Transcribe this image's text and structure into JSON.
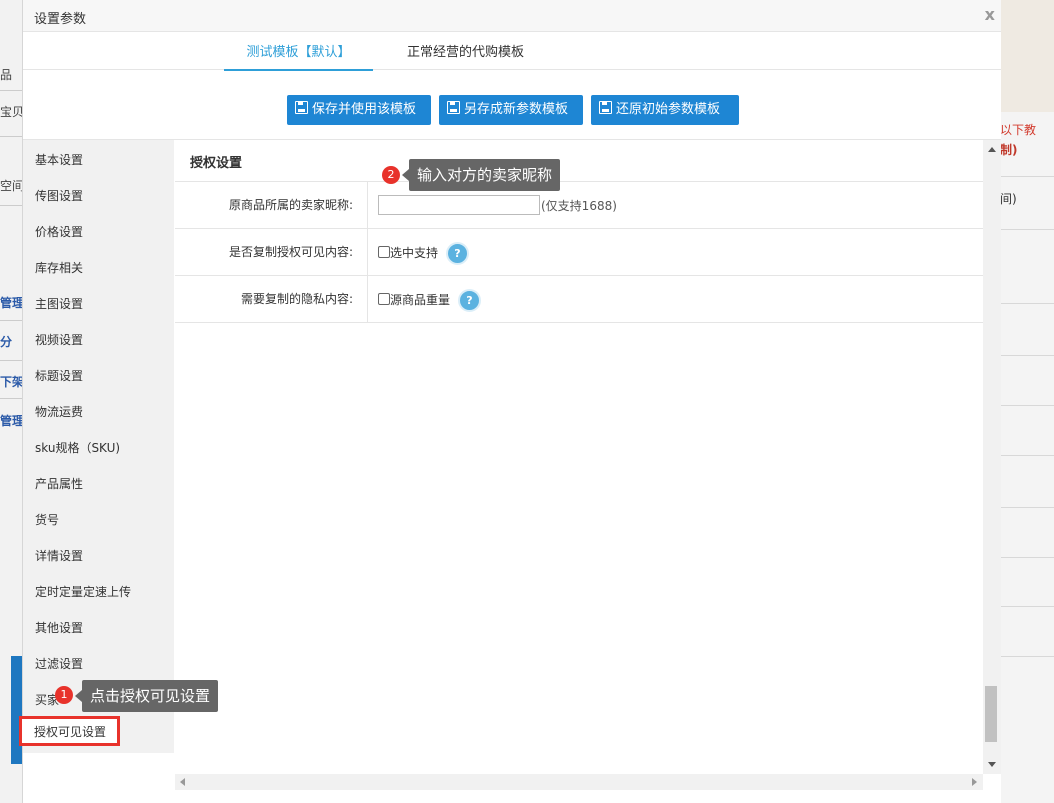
{
  "dialog": {
    "title": "设置参数",
    "close_label": "x"
  },
  "tabs": [
    {
      "label": "测试模板【默认】",
      "active": true
    },
    {
      "label": "正常经营的代购模板",
      "active": false
    }
  ],
  "toolbar": {
    "save_use_label": "保存并使用该模板",
    "save_as_label": "另存成新参数模板",
    "restore_label": "还原初始参数模板"
  },
  "menu": {
    "items": [
      "基本设置",
      "传图设置",
      "价格设置",
      "库存相关",
      "主图设置",
      "视频设置",
      "标题设置",
      "物流运费",
      "sku规格（SKU)",
      "产品属性",
      "货号",
      "详情设置",
      "定时定量定速上传",
      "其他设置",
      "过滤设置",
      "买家",
      "授权可见设置"
    ],
    "selected": "授权可见设置"
  },
  "section": {
    "title": "授权设置",
    "rows": [
      {
        "label": "原商品所属的卖家昵称:",
        "input_value": "",
        "hint": "(仅支持1688)"
      },
      {
        "label": "是否复制授权可见内容:",
        "checkbox_label": "选中支持",
        "checked": false
      },
      {
        "label": "需要复制的隐私内容:",
        "checkbox_label": "源商品重量",
        "checked": false
      }
    ],
    "help_glyph": "?"
  },
  "annotations": [
    {
      "number": "1",
      "text": "点击授权可见设置"
    },
    {
      "number": "2",
      "text": "输入对方的卖家昵称"
    }
  ],
  "background": {
    "left_fragments": [
      "品",
      "宝贝",
      "空间",
      "管理",
      "分",
      "下架",
      "管理"
    ],
    "right_fragments": [
      "以下教",
      "制)",
      "间)"
    ]
  },
  "colors": {
    "primary_button": "#1e86d4",
    "active_tab": "#2e9fd8",
    "highlight_border": "#e8322b",
    "callout_bg": "#666666"
  },
  "icons": {
    "button_icon": "save-icon",
    "help_icon": "question-icon"
  }
}
